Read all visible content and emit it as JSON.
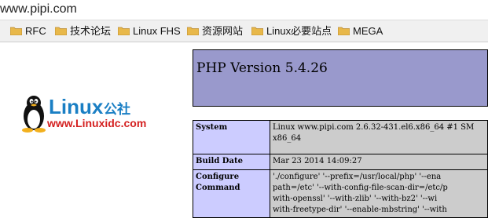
{
  "browser": {
    "url": "www.pipi.com",
    "bookmarks": [
      {
        "label": "RFC",
        "icon": "folder-icon"
      },
      {
        "label": "技术论坛",
        "icon": "folder-icon"
      },
      {
        "label": "Linux FHS",
        "icon": "folder-icon"
      },
      {
        "label": "资源网站",
        "icon": "folder-icon"
      },
      {
        "label": "Linux必要站点",
        "icon": "folder-icon"
      },
      {
        "label": "MEGA",
        "icon": "folder-icon"
      }
    ]
  },
  "logo": {
    "brand": "Linux",
    "brand_cn": "公社",
    "site": "www.Linuxidc.com",
    "colors": {
      "brand": "#1a7fc4",
      "site": "#d42020"
    }
  },
  "php": {
    "title": "PHP Version 5.4.26",
    "colors": {
      "header": "#9999cc",
      "label_cell": "#ccccff",
      "value_cell": "#cccccc"
    },
    "rows": [
      {
        "label": "System",
        "lines": [
          "Linux www.pipi.com 2.6.32-431.el6.x86_64 #1 SM",
          "x86_64"
        ]
      },
      {
        "label": "Build Date",
        "lines": [
          "Mar 23 2014 14:09:27"
        ]
      },
      {
        "label": "Configure Command",
        "lines": [
          "'./configure' '--prefix=/usr/local/php' '--ena",
          "path=/etc' '--with-config-file-scan-dir=/etc/p",
          "with-openssl' '--with-zlib' '--with-bz2' '--wi",
          "with-freetype-dir' '--enable-mbstring' '--with"
        ]
      }
    ]
  }
}
